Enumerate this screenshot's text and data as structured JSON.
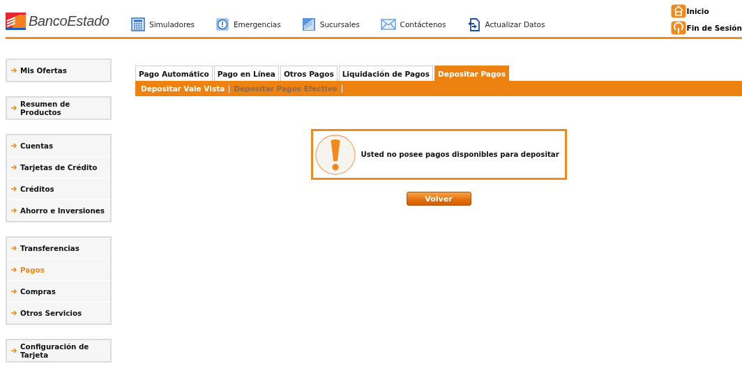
{
  "logo": {
    "text": "BancoEstado"
  },
  "nav": [
    {
      "label": "Simuladores",
      "kind": "calculator"
    },
    {
      "label": "Emergencias",
      "kind": "alert"
    },
    {
      "label": "Sucursales",
      "kind": "building"
    },
    {
      "label": "Contáctenos",
      "kind": "mail"
    },
    {
      "label": "Actualizar Datos",
      "kind": "refresh"
    }
  ],
  "top_links": [
    {
      "label": "Inicio",
      "kind": "home"
    },
    {
      "label": "Fin de Sesión",
      "kind": "power"
    }
  ],
  "sidebar": {
    "groups": [
      {
        "items": [
          {
            "label": "Mis Ofertas",
            "selected": false
          }
        ]
      },
      {
        "items": [
          {
            "label": "Resumen de Productos",
            "selected": false
          }
        ]
      },
      {
        "items": [
          {
            "label": "Cuentas",
            "selected": false
          },
          {
            "label": "Tarjetas de Crédito",
            "selected": false
          },
          {
            "label": "Créditos",
            "selected": false
          },
          {
            "label": "Ahorro e Inversiones",
            "selected": false
          }
        ]
      },
      {
        "items": [
          {
            "label": "Transferencias",
            "selected": false
          },
          {
            "label": "Pagos",
            "selected": true
          },
          {
            "label": "Compras",
            "selected": false
          },
          {
            "label": "Otros Servicios",
            "selected": false
          }
        ]
      },
      {
        "items": [
          {
            "label": "Configuración de Tarjeta",
            "selected": false
          }
        ]
      }
    ]
  },
  "tabs": [
    {
      "label": "Pago Automático",
      "selected": false
    },
    {
      "label": "Pago en Línea",
      "selected": false
    },
    {
      "label": "Otros Pagos",
      "selected": false
    },
    {
      "label": "Liquidación de Pagos",
      "selected": false
    },
    {
      "label": "Depositar Pagos",
      "selected": true
    }
  ],
  "subtabs": [
    {
      "label": "Depositar Vale Vista",
      "selected": false
    },
    {
      "label": "Depositar Pagos Efectivo",
      "selected": true
    }
  ],
  "message": {
    "text": "Usted no posee pagos disponibles para depositar"
  },
  "buttons": [
    "Volver"
  ]
}
